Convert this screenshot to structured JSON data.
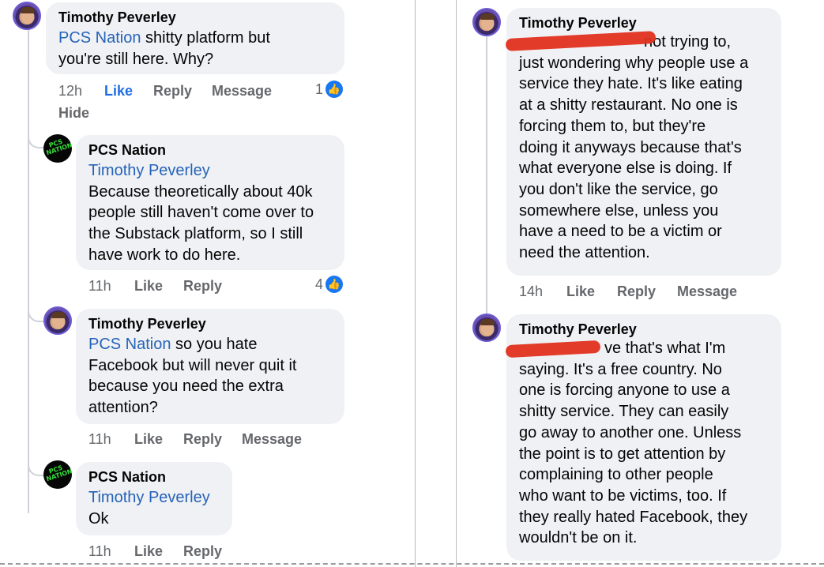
{
  "left_column": {
    "c1": {
      "author": "Timothy Peverley",
      "mention": "PCS Nation",
      "text_line1": " shitty platform but",
      "text_line2": "you're still here.  Why?",
      "time": "12h",
      "like": "Like",
      "reply": "Reply",
      "message": "Message",
      "reaction_count": "1",
      "hide": "Hide"
    },
    "c2": {
      "author": "PCS Nation",
      "mention": "Timothy Peverley",
      "lines": [
        "Because theoretically about 40k",
        "people still haven't come over to",
        "the Substack platform, so I still",
        "have work to do here."
      ],
      "time": "11h",
      "like": "Like",
      "reply": "Reply",
      "reaction_count": "4",
      "avatar_text": "PCS NATION"
    },
    "c3": {
      "author": "Timothy Peverley",
      "mention": "PCS Nation",
      "text_line1": " so you hate",
      "lines": [
        "Facebook but will never quit it",
        "because you need the extra",
        "attention?"
      ],
      "time": "11h",
      "like": "Like",
      "reply": "Reply",
      "message": "Message"
    },
    "c4": {
      "author": "PCS Nation",
      "mention": "Timothy Peverley",
      "text": "Ok",
      "time": "11h",
      "like": "Like",
      "reply": "Reply",
      "avatar_text": "PCS NATION"
    }
  },
  "right_column": {
    "c5": {
      "author": "Timothy Peverley",
      "first_line_visible": "not trying to,",
      "lines": [
        "just wondering why people use a",
        "service they hate. It's like eating",
        "at a shitty restaurant. No one is",
        "forcing them to, but they're",
        "doing it anyways because that's",
        "what everyone else is doing. If",
        "you don't like the service, go",
        "somewhere else, unless you",
        "have a need to be a victim or",
        "need the attention."
      ],
      "time": "14h",
      "like": "Like",
      "reply": "Reply",
      "message": "Message"
    },
    "c6": {
      "author": "Timothy Peverley",
      "first_line_visible": "ve that's what I'm",
      "lines": [
        "saying. It's a free country. No",
        "one is forcing anyone to use a",
        "shitty service. They can easily",
        "go away to another one. Unless",
        "the point is to get attention by",
        "complaining to other people",
        "who want to be victims, too. If",
        "they really hated Facebook, they",
        "wouldn't be on it."
      ]
    }
  },
  "colors": {
    "bubble": "#eff1f4",
    "mention": "#2663b8",
    "like_active": "#1f6ee6",
    "meta_gray": "#65676b",
    "redaction": "#e0301e"
  }
}
